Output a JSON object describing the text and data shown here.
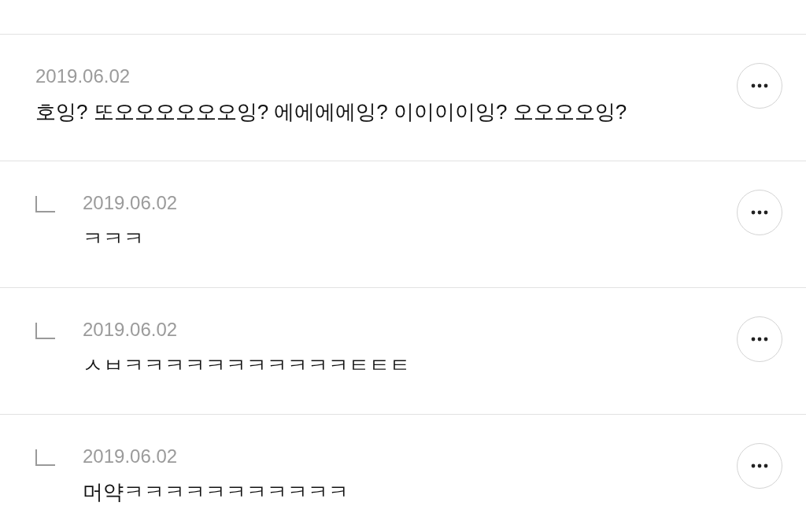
{
  "comments": [
    {
      "kind": "comment",
      "date": "2019.06.02",
      "text": "호잉? 또오오오오오오잉? 에에에에잉? 이이이이잉? 오오오오잉?"
    },
    {
      "kind": "reply",
      "date": "2019.06.02",
      "text": "ㅋㅋㅋ"
    },
    {
      "kind": "reply",
      "date": "2019.06.02",
      "text": "ㅅㅂㅋㅋㅋㅋㅋㅋㅋㅋㅋㅋㅋㅌㅌㅌ"
    },
    {
      "kind": "reply",
      "date": "2019.06.02",
      "text": "머약ㅋㅋㅋㅋㅋㅋㅋㅋㅋㅋㅋ"
    }
  ]
}
